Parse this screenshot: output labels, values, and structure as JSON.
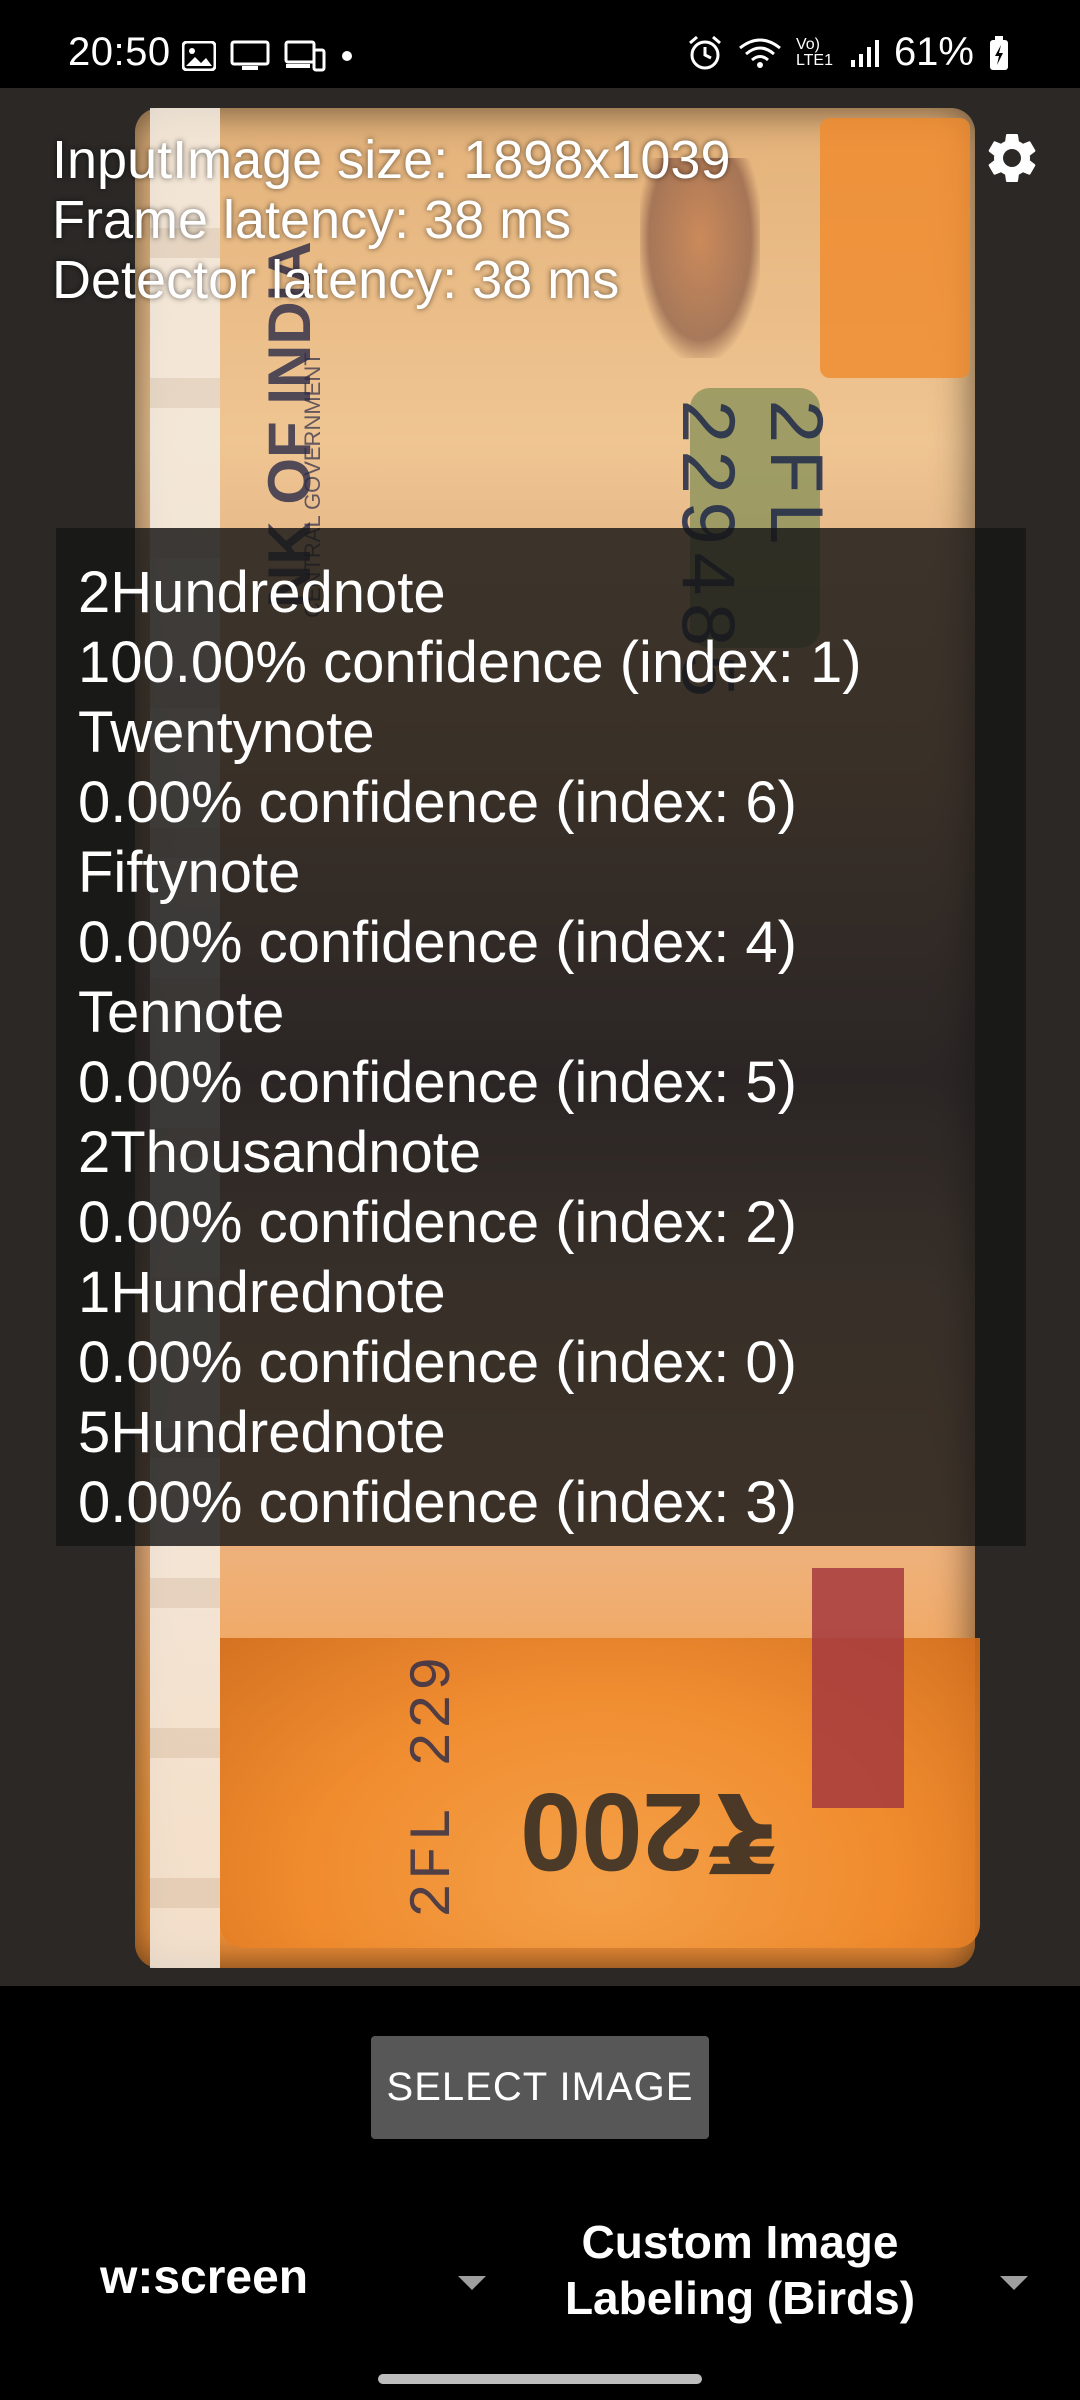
{
  "status_bar": {
    "time": "20:50",
    "battery": "61%",
    "network_label": "Vo) LTE1",
    "icons": [
      "gallery-icon",
      "screen-cast-icon",
      "devices-icon",
      "dot-icon",
      "alarm-icon",
      "wifi-icon",
      "signal-icon",
      "battery-charging-icon"
    ]
  },
  "stats": {
    "input_size": "InputImage size: 1898x1039",
    "frame_latency": "Frame latency: 38 ms",
    "detector_latency": "Detector latency: 38 ms"
  },
  "settings": {
    "icon": "gear-icon"
  },
  "results": [
    {
      "label": "2Hundrednote",
      "detail": "100.00% confidence (index: 1)"
    },
    {
      "label": "Twentynote",
      "detail": "0.00% confidence (index: 6)"
    },
    {
      "label": "Fiftynote",
      "detail": "0.00% confidence (index: 4)"
    },
    {
      "label": "Tennote",
      "detail": "0.00% confidence (index: 5)"
    },
    {
      "label": "2Thousandnote",
      "detail": "0.00% confidence (index: 2)"
    },
    {
      "label": "1Hundrednote",
      "detail": "0.00% confidence (index: 0)"
    },
    {
      "label": "5Hundrednote",
      "detail": "0.00% confidence (index: 3)"
    }
  ],
  "photo_text": {
    "serial_top": "2FL 229485",
    "serial_bottom": "2FL 229",
    "bank": "NK OF INDIA",
    "govt": "CENTRAL GOVERNMENT",
    "amount": "₹200"
  },
  "controls": {
    "select_image": "SELECT IMAGE",
    "size_spinner": "w:screen",
    "model_spinner_line1": "Custom Image",
    "model_spinner_line2": "Labeling (Birds)"
  }
}
